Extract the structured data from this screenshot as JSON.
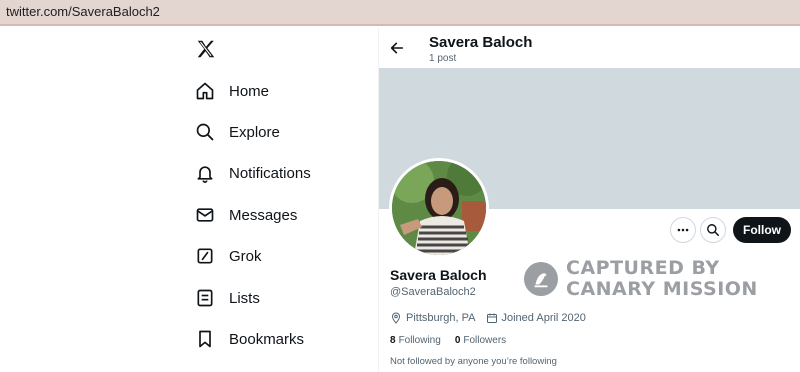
{
  "browser": {
    "url": "twitter.com/SaveraBaloch2"
  },
  "sidebar": {
    "logo_icon": "x-logo-icon",
    "items": [
      {
        "label": "Home",
        "icon": "home-icon"
      },
      {
        "label": "Explore",
        "icon": "search-icon"
      },
      {
        "label": "Notifications",
        "icon": "bell-icon"
      },
      {
        "label": "Messages",
        "icon": "envelope-icon"
      },
      {
        "label": "Grok",
        "icon": "grok-icon"
      },
      {
        "label": "Lists",
        "icon": "list-icon"
      },
      {
        "label": "Bookmarks",
        "icon": "bookmark-icon"
      }
    ]
  },
  "header": {
    "name": "Savera Baloch",
    "posts": "1 post"
  },
  "profile": {
    "name": "Savera Baloch",
    "handle": "@SaveraBaloch2",
    "location": "Pittsburgh, PA",
    "joined": "Joined April 2020",
    "following_count": "8",
    "following_label": "Following",
    "followers_count": "0",
    "followers_label": "Followers",
    "not_followed": "Not followed by anyone you’re following",
    "follow_label": "Follow"
  },
  "watermark": {
    "line1": "CAPTURED BY",
    "line2": "CANARY MISSION"
  },
  "colors": {
    "banner": "#cfd9de",
    "follow_bg": "#0f1419",
    "muted": "#536471"
  }
}
